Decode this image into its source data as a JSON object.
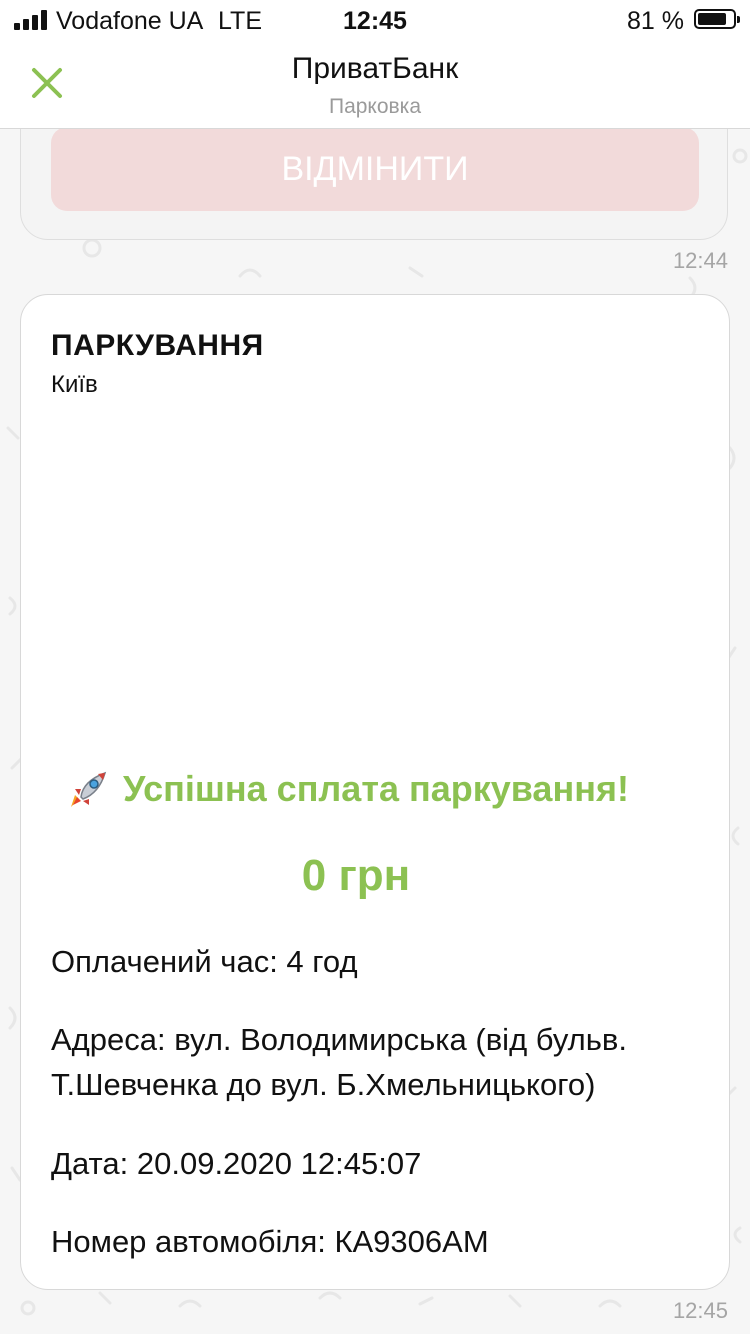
{
  "status_bar": {
    "carrier": "Vodafone UA",
    "network": "LTE",
    "time": "12:45",
    "battery": "81 %",
    "battery_level": 0.81
  },
  "header": {
    "title": "ПриватБанк",
    "subtitle": "Парковка",
    "close_icon": "close-icon",
    "accent_color": "#8cc152"
  },
  "previous_message": {
    "button_label": "ВІДМІНИТИ",
    "time": "12:44"
  },
  "card": {
    "title": "ПАРКУВАННЯ",
    "city": "Київ",
    "success_icon": "rocket-icon",
    "success_text": "Успішна сплата паркування!",
    "amount": "0 грн",
    "paid_time": "Оплачений час: 4 год",
    "address": "Адреса: вул. Володимирська (від бульв. Т.Шевченка до вул. Б.Хмельницького)",
    "date": "Дата: 20.09.2020 12:45:07",
    "car_number": "Номер автомобіля: КА9306АМ",
    "time": "12:45"
  }
}
